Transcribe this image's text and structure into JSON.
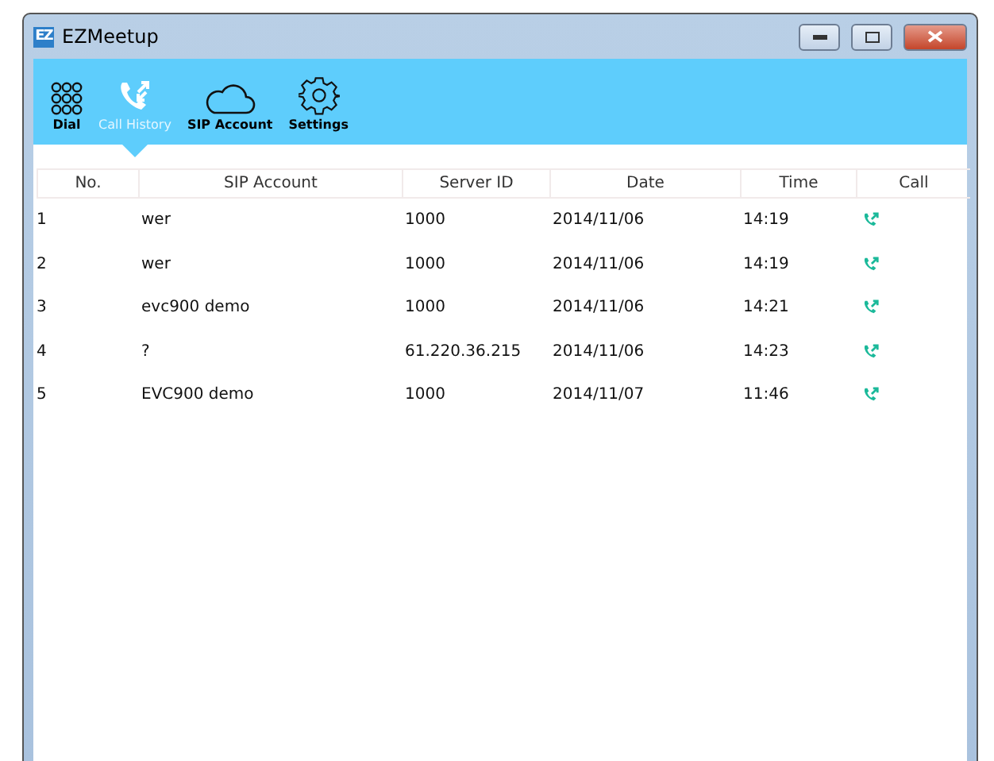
{
  "window": {
    "title": "EZMeetup",
    "logo": "EZ"
  },
  "toolbar": [
    {
      "kind": "dial",
      "label": "Dial",
      "selected": false
    },
    {
      "kind": "history",
      "label": "Call History",
      "selected": true
    },
    {
      "kind": "cloud",
      "label": "SIP Account",
      "selected": false
    },
    {
      "kind": "gear",
      "label": "Settings",
      "selected": false
    }
  ],
  "table": {
    "columns": [
      "No.",
      "SIP Account",
      "Server ID",
      "Date",
      "Time",
      "Call"
    ],
    "rows": [
      {
        "no": "1",
        "account": "wer",
        "server": "1000",
        "date": "2014/11/06",
        "time": "14:19"
      },
      {
        "no": "2",
        "account": "wer",
        "server": "1000",
        "date": "2014/11/06",
        "time": "14:19"
      },
      {
        "no": "3",
        "account": "evc900 demo",
        "server": "1000",
        "date": "2014/11/06",
        "time": "14:21"
      },
      {
        "no": "4",
        "account": "?",
        "server": "61.220.36.215",
        "date": "2014/11/06",
        "time": "14:23"
      },
      {
        "no": "5",
        "account": "EVC900 demo",
        "server": "1000",
        "date": "2014/11/07",
        "time": "11:46"
      }
    ]
  }
}
